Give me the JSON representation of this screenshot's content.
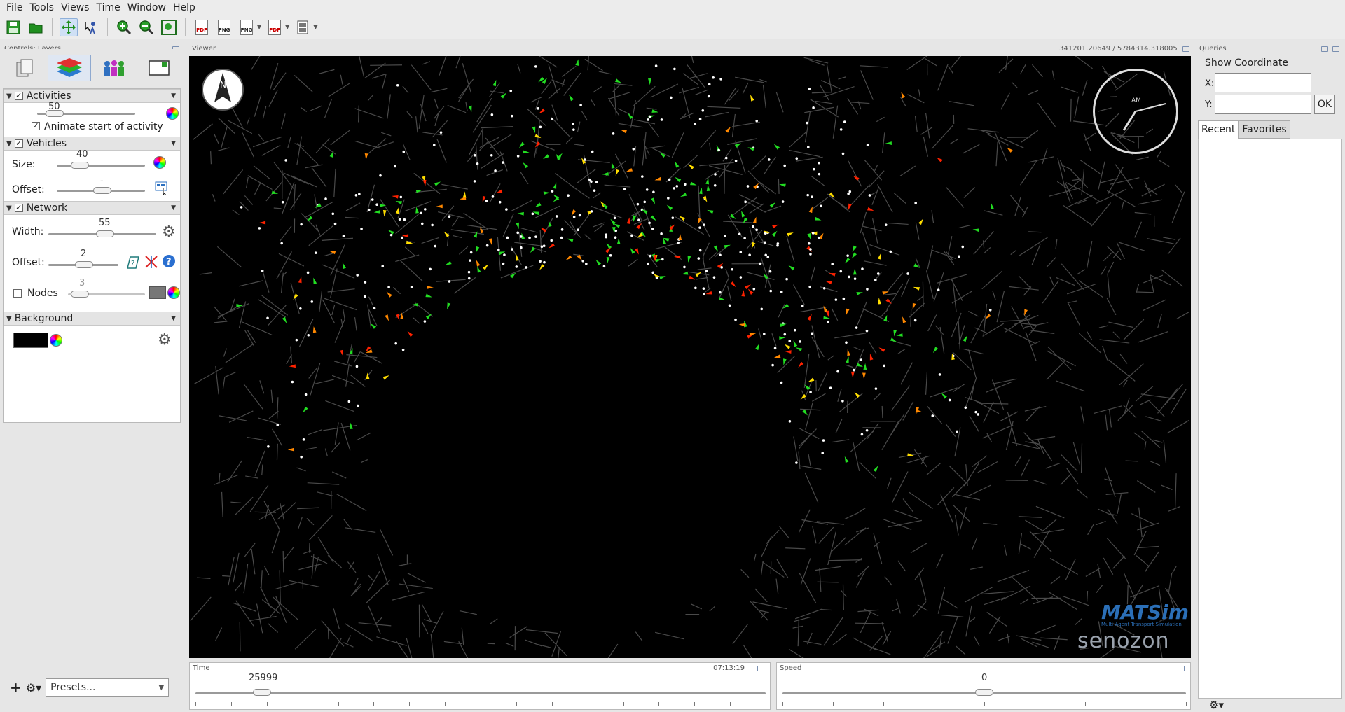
{
  "menu": [
    "File",
    "Tools",
    "Views",
    "Time",
    "Window",
    "Help"
  ],
  "toolbar": {
    "pdf_label": "PDF",
    "png_label": "PNG"
  },
  "controls": {
    "panel_title": "Controls: Layers",
    "activities": {
      "title": "Activities",
      "slider_value": "50",
      "animate_label": "Animate start of activity"
    },
    "vehicles": {
      "title": "Vehicles",
      "size_label": "Size:",
      "size_value": "40",
      "offset_label": "Offset:",
      "offset_value": "-"
    },
    "network": {
      "title": "Network",
      "width_label": "Width:",
      "width_value": "55",
      "offset_label": "Offset:",
      "offset_value": "2",
      "nodes_label": "Nodes",
      "nodes_value": "3"
    },
    "background": {
      "title": "Background",
      "color": "#000000"
    },
    "presets_placeholder": "Presets..."
  },
  "viewer": {
    "panel_title": "Viewer",
    "coordinates": "341201.20649 / 5784314.318005",
    "compass_letter": "N",
    "clock_label": "AM",
    "logo_main": "MATSim",
    "logo_sub": "Multi-Agent Transport Simulation",
    "logo_company": "senozon"
  },
  "queries": {
    "panel_title": "Queries",
    "heading": "Show Coordinate",
    "x_label": "X:",
    "y_label": "Y:",
    "ok_label": "OK",
    "tabs": [
      "Recent",
      "Favorites"
    ]
  },
  "time": {
    "panel_title": "Time",
    "clock_readout": "07:13:19",
    "slider_value": "25999"
  },
  "speed": {
    "panel_title": "Speed",
    "slider_value": "0"
  },
  "colors": {
    "accent": "#2b6fb7",
    "vehicle_green": "#22dd22",
    "vehicle_red": "#ff2200",
    "vehicle_orange": "#ff8800",
    "vehicle_yellow": "#ffdd00",
    "network": "#4a4a4a"
  }
}
